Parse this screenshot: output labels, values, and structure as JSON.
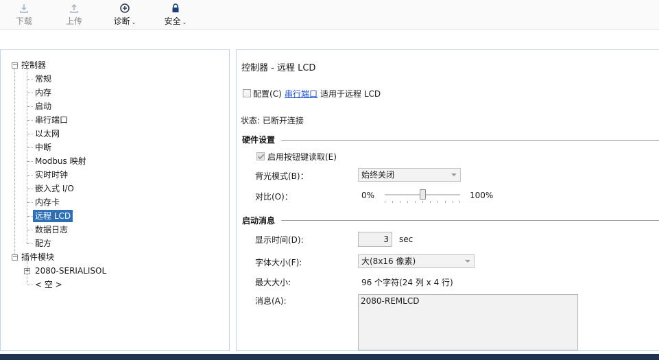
{
  "toolbar": {
    "download_label": "下载",
    "upload_label": "上传",
    "diagnose_label": "诊断",
    "security_label": "安全"
  },
  "tree": {
    "controller": "控制器",
    "items": [
      "常规",
      "内存",
      "启动",
      "串行端口",
      "以太网",
      "中断",
      "Modbus 映射",
      "实时时钟",
      "嵌入式 I/O",
      "内存卡",
      "远程 LCD",
      "数据日志",
      "配方"
    ],
    "selected_index": 10,
    "plugin_modules": "插件模块",
    "plugin_children": [
      "2080-SERIALISOL",
      "< 空 >"
    ]
  },
  "content": {
    "title": "控制器 - 远程 LCD",
    "configure_label": "配置(C)",
    "serial_port_link": "串行端口",
    "applies_to": "适用于远程 LCD",
    "status": "状态: 已断开连接",
    "hardware_section": "硬件设置",
    "enable_keys_label": "启用按钮键读取(E)",
    "backlight_label": "背光模式(B)：",
    "backlight_value": "始终关闭",
    "contrast_label": "对比(O)：",
    "contrast_min": "0%",
    "contrast_max": "100%",
    "contrast_value_percent": 50,
    "startup_section": "启动消息",
    "display_time_label": "显示时间(D):",
    "display_time_value": "3",
    "display_time_unit": "sec",
    "font_size_label": "字体大小(F):",
    "font_size_value": "大(8x16 像素)",
    "max_size_label": "最大大小:",
    "max_size_value": "96 个字符(24 列 x 4 行)",
    "message_label": "消息(A):",
    "message_value": "2080-REMLCD"
  }
}
